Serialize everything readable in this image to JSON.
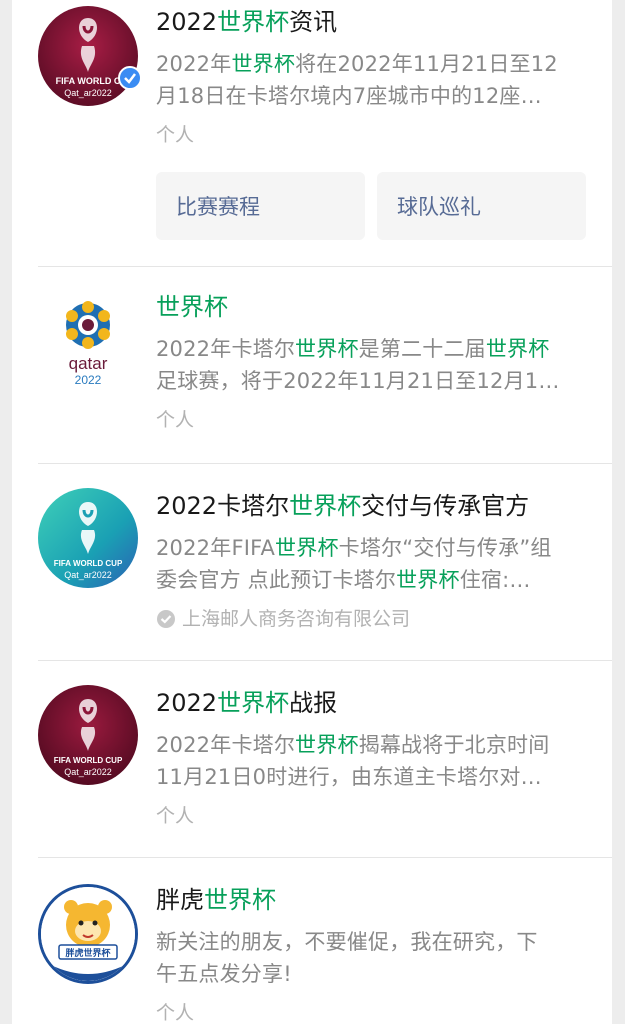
{
  "accounts": [
    {
      "title_pre": "2022",
      "title_hl": "世界杯",
      "title_post": "资讯",
      "desc": [
        [
          {
            "t": "2022年"
          },
          {
            "t": "世界杯",
            "hl": true
          },
          {
            "t": "将在2022年11月21日至12"
          }
        ],
        [
          {
            "t": "月18日在卡塔尔境内7座城市中的12座…"
          }
        ]
      ],
      "meta": "个人",
      "services": [
        "比赛赛程",
        "球队巡礼"
      ],
      "avatar_text": [
        "FIFA WORLD C",
        "Qat_ar2022"
      ]
    },
    {
      "title_pre": "",
      "title_hl": "世界杯",
      "title_post": "",
      "desc": [
        [
          {
            "t": "2022年卡塔尔"
          },
          {
            "t": "世界杯",
            "hl": true
          },
          {
            "t": "是第二十二届"
          },
          {
            "t": "世界杯",
            "hl": true
          }
        ],
        [
          {
            "t": "足球赛，将于2022年11月21日至12月1…"
          }
        ]
      ],
      "meta": "个人",
      "avatar_text": [
        "qatar",
        "2022"
      ]
    },
    {
      "title_pre": "2022卡塔尔",
      "title_hl": "世界杯",
      "title_post": "交付与传承官方",
      "desc": [
        [
          {
            "t": "2022年FIFA"
          },
          {
            "t": "世界杯",
            "hl": true
          },
          {
            "t": "卡塔尔“交付与传承”组"
          }
        ],
        [
          {
            "t": "委会官方 点此预订卡塔尔"
          },
          {
            "t": "世界杯",
            "hl": true
          },
          {
            "t": "住宿:…"
          }
        ]
      ],
      "meta": "上海邮人商务咨询有限公司",
      "avatar_text": [
        "FIFA WORLD CUP",
        "Qat_ar2022"
      ]
    },
    {
      "title_pre": "2022",
      "title_hl": "世界杯",
      "title_post": "战报",
      "desc": [
        [
          {
            "t": "2022年卡塔尔"
          },
          {
            "t": "世界杯",
            "hl": true
          },
          {
            "t": "揭幕战将于北京时间"
          }
        ],
        [
          {
            "t": "11月21日0时进行，由东道主卡塔尔对…"
          }
        ]
      ],
      "meta": "个人",
      "avatar_text": [
        "FIFA WORLD CUP",
        "Qat_ar2022"
      ]
    },
    {
      "title_pre": "胖虎",
      "title_hl": "世界杯",
      "title_post": "",
      "desc": [
        [
          {
            "t": "新关注的朋友，不要催促，我在研究，下"
          }
        ],
        [
          {
            "t": "午五点发分享!"
          }
        ]
      ],
      "meta": "个人",
      "avatar_text": [
        "胖虎世界杯"
      ]
    }
  ],
  "colors": {
    "highlight": "#07a05a",
    "link": "#576b95",
    "maroon": "#8a1538"
  }
}
